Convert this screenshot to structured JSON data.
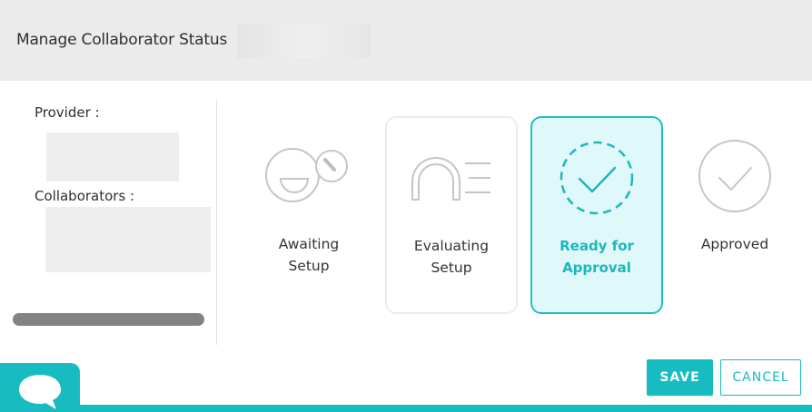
{
  "header": {
    "title": "Manage Collaborator Status"
  },
  "sidebar": {
    "provider_label": "Provider :",
    "collaborators_label": "Collaborators :"
  },
  "statuses": [
    {
      "line1": "Awaiting",
      "line2": "Setup",
      "icon": "gauge-face-icon",
      "selected": false
    },
    {
      "line1": "Evaluating",
      "line2": "Setup",
      "icon": "arch-lines-icon",
      "selected": false
    },
    {
      "line1": "Ready for",
      "line2": "Approval",
      "icon": "dashed-check-circle-icon",
      "selected": true
    },
    {
      "line1": "Approved",
      "line2": "",
      "icon": "check-circle-icon",
      "selected": false
    }
  ],
  "actions": {
    "save_label": "SAVE",
    "cancel_label": "CANCEL"
  },
  "colors": {
    "accent": "#17bcc1",
    "selected_bg": "#dff9fb",
    "header_bg": "#ebebeb"
  }
}
